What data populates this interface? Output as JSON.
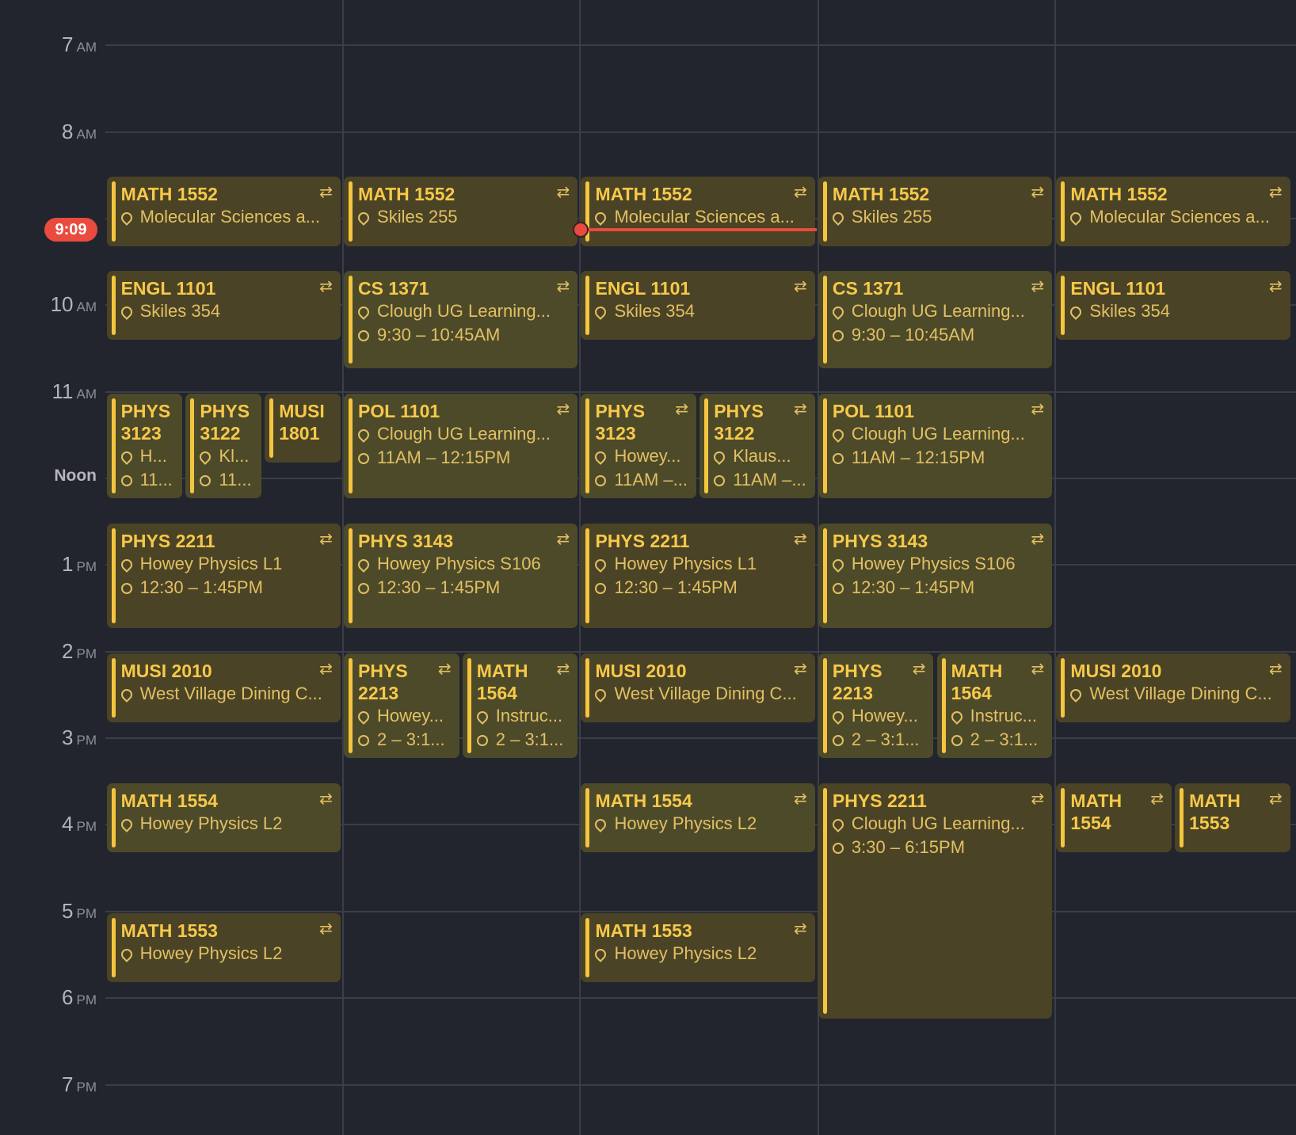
{
  "current_time": "9:09",
  "hours": [
    {
      "n": "7",
      "ap": "AM"
    },
    {
      "n": "8",
      "ap": "AM"
    },
    {
      "n": "9",
      "ap": "AM"
    },
    {
      "n": "10",
      "ap": "AM"
    },
    {
      "n": "11",
      "ap": "AM"
    },
    {
      "n": "Noon",
      "ap": ""
    },
    {
      "n": "1",
      "ap": "PM"
    },
    {
      "n": "2",
      "ap": "PM"
    },
    {
      "n": "3",
      "ap": "PM"
    },
    {
      "n": "4",
      "ap": "PM"
    },
    {
      "n": "5",
      "ap": "PM"
    },
    {
      "n": "6",
      "ap": "PM"
    },
    {
      "n": "7",
      "ap": "PM"
    }
  ],
  "events": [
    {
      "day": 0,
      "start": "8:30",
      "end": "9:20",
      "title": "MATH 1552",
      "location": "Molecular Sciences a...",
      "time": "",
      "repeat": true
    },
    {
      "day": 1,
      "start": "8:30",
      "end": "9:20",
      "title": "MATH 1552",
      "location": "Skiles 255",
      "time": "",
      "repeat": true
    },
    {
      "day": 2,
      "start": "8:30",
      "end": "9:20",
      "title": "MATH 1552",
      "location": "Molecular Sciences a...",
      "time": "",
      "repeat": true
    },
    {
      "day": 3,
      "start": "8:30",
      "end": "9:20",
      "title": "MATH 1552",
      "location": "Skiles 255",
      "time": "",
      "repeat": true
    },
    {
      "day": 4,
      "start": "8:30",
      "end": "9:20",
      "title": "MATH 1552",
      "location": "Molecular Sciences a...",
      "time": "",
      "repeat": true
    },
    {
      "day": 0,
      "start": "9:35",
      "end": "10:25",
      "title": "ENGL 1101",
      "location": "Skiles 354",
      "time": "",
      "repeat": true
    },
    {
      "day": 1,
      "start": "9:35",
      "end": "10:45",
      "title": "CS 1371",
      "location": "Clough UG Learning...",
      "time": "9:30 – 10:45AM",
      "repeat": true,
      "shade": "lite"
    },
    {
      "day": 2,
      "start": "9:35",
      "end": "10:25",
      "title": "ENGL 1101",
      "location": "Skiles 354",
      "time": "",
      "repeat": true
    },
    {
      "day": 3,
      "start": "9:35",
      "end": "10:45",
      "title": "CS 1371",
      "location": "Clough UG Learning...",
      "time": "9:30 – 10:45AM",
      "repeat": true,
      "shade": "lite"
    },
    {
      "day": 4,
      "start": "9:35",
      "end": "10:25",
      "title": "ENGL 1101",
      "location": "Skiles 354",
      "time": "",
      "repeat": true
    },
    {
      "day": 0,
      "start": "11:00",
      "end": "12:15",
      "col": 0,
      "cols": 3,
      "title": "PHYS 3123",
      "location": "H...",
      "time": "11...",
      "repeat": false,
      "shade": "lite"
    },
    {
      "day": 0,
      "start": "11:00",
      "end": "12:15",
      "col": 1,
      "cols": 3,
      "title": "PHYS 3122",
      "location": "Kl...",
      "time": "11...",
      "repeat": false,
      "shade": "lite"
    },
    {
      "day": 0,
      "start": "11:00",
      "end": "11:50",
      "col": 2,
      "cols": 3,
      "title": "MUSI 1801",
      "location": "",
      "time": "",
      "repeat": false
    },
    {
      "day": 1,
      "start": "11:00",
      "end": "12:15",
      "title": "POL 1101",
      "location": "Clough UG Learning...",
      "time": "11AM – 12:15PM",
      "repeat": true,
      "shade": "lite"
    },
    {
      "day": 2,
      "start": "11:00",
      "end": "12:15",
      "col": 0,
      "cols": 2,
      "title": "PHYS 3123",
      "location": "Howey...",
      "time": "11AM –...",
      "repeat": true,
      "shade": "lite"
    },
    {
      "day": 2,
      "start": "11:00",
      "end": "12:15",
      "col": 1,
      "cols": 2,
      "title": "PHYS 3122",
      "location": "Klaus...",
      "time": "11AM –...",
      "repeat": true,
      "shade": "lite"
    },
    {
      "day": 3,
      "start": "11:00",
      "end": "12:15",
      "title": "POL 1101",
      "location": "Clough UG Learning...",
      "time": "11AM – 12:15PM",
      "repeat": true,
      "shade": "lite"
    },
    {
      "day": 0,
      "start": "12:30",
      "end": "13:45",
      "title": "PHYS 2211",
      "location": "Howey Physics L1",
      "time": "12:30 – 1:45PM",
      "repeat": true
    },
    {
      "day": 1,
      "start": "12:30",
      "end": "13:45",
      "title": "PHYS 3143",
      "location": "Howey Physics S106",
      "time": "12:30 – 1:45PM",
      "repeat": true,
      "shade": "lite"
    },
    {
      "day": 2,
      "start": "12:30",
      "end": "13:45",
      "title": "PHYS 2211",
      "location": "Howey Physics L1",
      "time": "12:30 – 1:45PM",
      "repeat": true
    },
    {
      "day": 3,
      "start": "12:30",
      "end": "13:45",
      "title": "PHYS 3143",
      "location": "Howey Physics S106",
      "time": "12:30 – 1:45PM",
      "repeat": true,
      "shade": "lite"
    },
    {
      "day": 0,
      "start": "14:00",
      "end": "14:50",
      "title": "MUSI 2010",
      "location": "West Village Dining C...",
      "time": "",
      "repeat": true
    },
    {
      "day": 1,
      "start": "14:00",
      "end": "15:15",
      "col": 0,
      "cols": 2,
      "title": "PHYS 2213",
      "location": "Howey...",
      "time": "2 – 3:1...",
      "repeat": true,
      "shade": "lite"
    },
    {
      "day": 1,
      "start": "14:00",
      "end": "15:15",
      "col": 1,
      "cols": 2,
      "title": "MATH 1564",
      "location": "Instruc...",
      "time": "2 – 3:1...",
      "repeat": true,
      "shade": "lite"
    },
    {
      "day": 2,
      "start": "14:00",
      "end": "14:50",
      "title": "MUSI 2010",
      "location": "West Village Dining C...",
      "time": "",
      "repeat": true
    },
    {
      "day": 3,
      "start": "14:00",
      "end": "15:15",
      "col": 0,
      "cols": 2,
      "title": "PHYS 2213",
      "location": "Howey...",
      "time": "2 – 3:1...",
      "repeat": true,
      "shade": "lite"
    },
    {
      "day": 3,
      "start": "14:00",
      "end": "15:15",
      "col": 1,
      "cols": 2,
      "title": "MATH 1564",
      "location": "Instruc...",
      "time": "2 – 3:1...",
      "repeat": true,
      "shade": "lite"
    },
    {
      "day": 4,
      "start": "14:00",
      "end": "14:50",
      "title": "MUSI 2010",
      "location": "West Village Dining C...",
      "time": "",
      "repeat": true
    },
    {
      "day": 0,
      "start": "15:30",
      "end": "16:20",
      "title": "MATH 1554",
      "location": "Howey Physics L2",
      "time": "",
      "repeat": true,
      "shade": "lite"
    },
    {
      "day": 2,
      "start": "15:30",
      "end": "16:20",
      "title": "MATH 1554",
      "location": "Howey Physics L2",
      "time": "",
      "repeat": true,
      "shade": "lite"
    },
    {
      "day": 3,
      "start": "15:30",
      "end": "18:15",
      "title": "PHYS 2211",
      "location": "Clough UG Learning...",
      "time": "3:30 – 6:15PM",
      "repeat": true
    },
    {
      "day": 4,
      "start": "15:30",
      "end": "16:20",
      "col": 0,
      "cols": 2,
      "title": "MATH 1554",
      "location": "",
      "time": "",
      "repeat": true
    },
    {
      "day": 4,
      "start": "15:30",
      "end": "16:20",
      "col": 1,
      "cols": 2,
      "title": "MATH 1553",
      "location": "",
      "time": "",
      "repeat": true
    },
    {
      "day": 0,
      "start": "17:00",
      "end": "17:50",
      "title": "MATH 1553",
      "location": "Howey Physics L2",
      "time": "",
      "repeat": true
    },
    {
      "day": 2,
      "start": "17:00",
      "end": "17:50",
      "title": "MATH 1553",
      "location": "Howey Physics L2",
      "time": "",
      "repeat": true
    }
  ],
  "colors": {
    "background": "#22252d",
    "event_bg": "#4b4326",
    "event_bg_alt": "#4d4a2a",
    "accent": "#f5c540",
    "now": "#e94b3e"
  },
  "icons": {
    "repeat": "repeat-icon",
    "location": "pin-icon",
    "time": "clock-icon"
  }
}
